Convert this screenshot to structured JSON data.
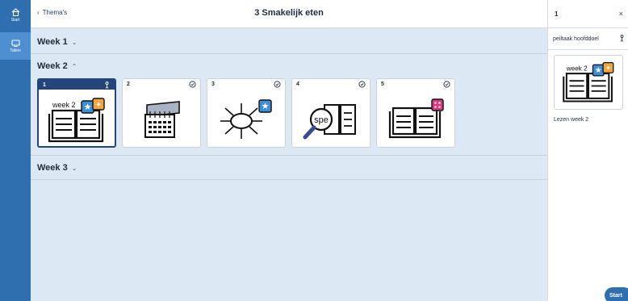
{
  "nav": {
    "items": [
      {
        "label": "Start",
        "icon": "home-icon"
      },
      {
        "label": "Taken",
        "icon": "tasks-icon"
      }
    ]
  },
  "header": {
    "back_label": "Thema's",
    "title": "3 Smakelijk eten"
  },
  "weeks": [
    {
      "label": "Week 1",
      "expanded": false
    },
    {
      "label": "Week 2",
      "expanded": true
    },
    {
      "label": "Week 3",
      "expanded": false
    }
  ],
  "lessons": [
    {
      "number": "1",
      "status": "person-icon",
      "selected": true,
      "image": "open-book-week2-icon",
      "image_text": "week 2"
    },
    {
      "number": "2",
      "status": "check-circle-icon",
      "selected": false,
      "image": "calendar-icon"
    },
    {
      "number": "3",
      "status": "check-circle-icon",
      "selected": false,
      "image": "mindmap-icon"
    },
    {
      "number": "4",
      "status": "check-circle-icon",
      "selected": false,
      "image": "magnifier-spelling-icon",
      "image_text": "spe"
    },
    {
      "number": "5",
      "status": "check-circle-icon",
      "selected": false,
      "image": "open-book-icon"
    }
  ],
  "panel": {
    "title": "1",
    "close_glyph": "×",
    "task_label": "peiltaak hoofddoel",
    "thumb_text": "week 2",
    "caption": "Lezen week 2",
    "start_label": "Start"
  },
  "colors": {
    "rail": "#2f6fb0",
    "selected_card": "#23467a",
    "background": "#dce8f3",
    "star_badge": "#3c8fd6",
    "orange_badge": "#f3a640",
    "pink_badge": "#e0357d"
  }
}
